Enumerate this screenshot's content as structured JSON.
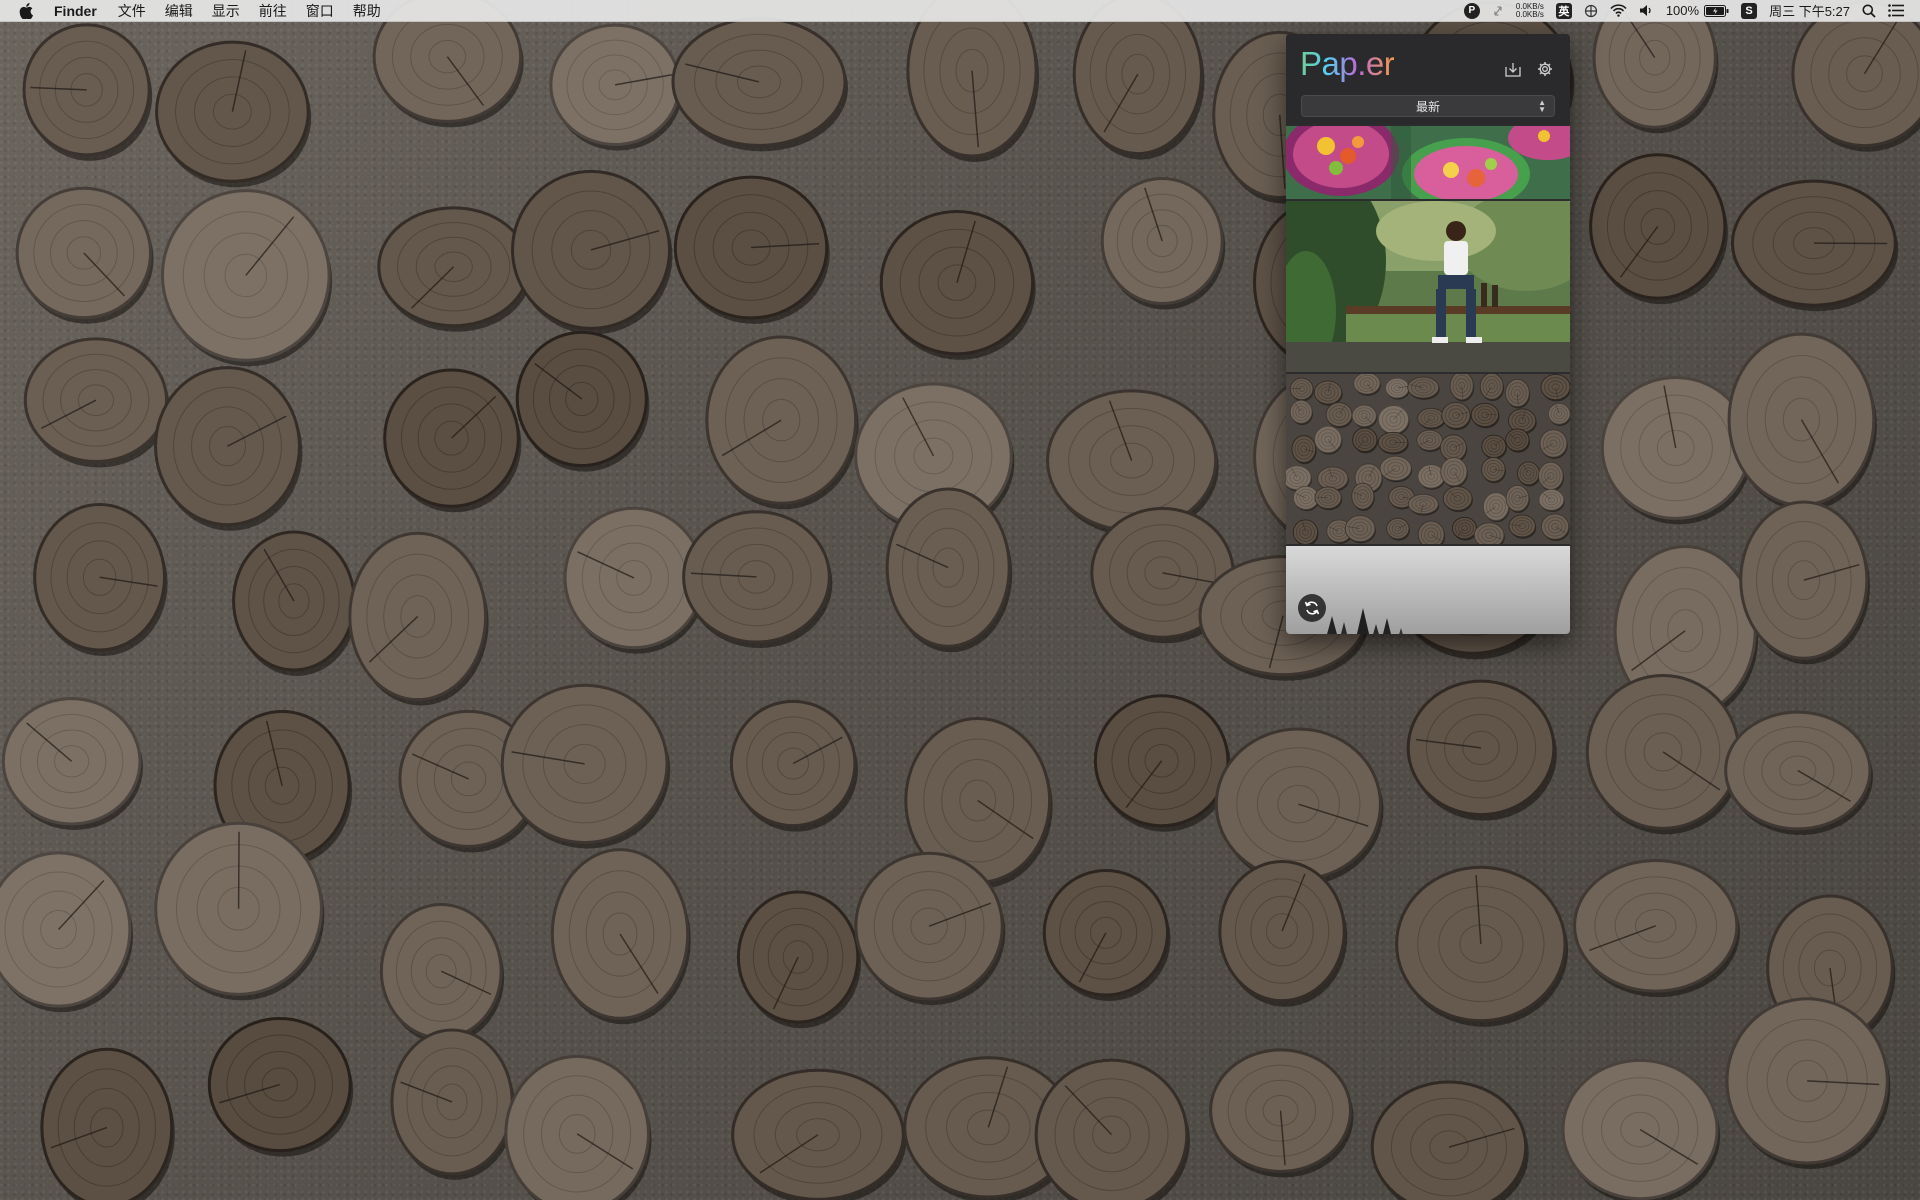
{
  "menubar": {
    "app_name": "Finder",
    "items": [
      {
        "label": "文件"
      },
      {
        "label": "编辑"
      },
      {
        "label": "显示"
      },
      {
        "label": "前往"
      },
      {
        "label": "窗口"
      },
      {
        "label": "帮助"
      }
    ],
    "tray": {
      "paper_badge": "P",
      "net_up": "0.0KB/s",
      "net_down": "0.0KB/s",
      "input_method": "英",
      "battery_percent": "100%",
      "sogou_badge": "S",
      "datetime": "周三 下午5:27"
    }
  },
  "paper": {
    "logo": "Pap.er",
    "sort_selected": "最新"
  },
  "colors": {
    "menubar_bg": "#e8e8e8",
    "panel_bg": "#2c2c2e",
    "select_bg": "#3a3a3c"
  }
}
